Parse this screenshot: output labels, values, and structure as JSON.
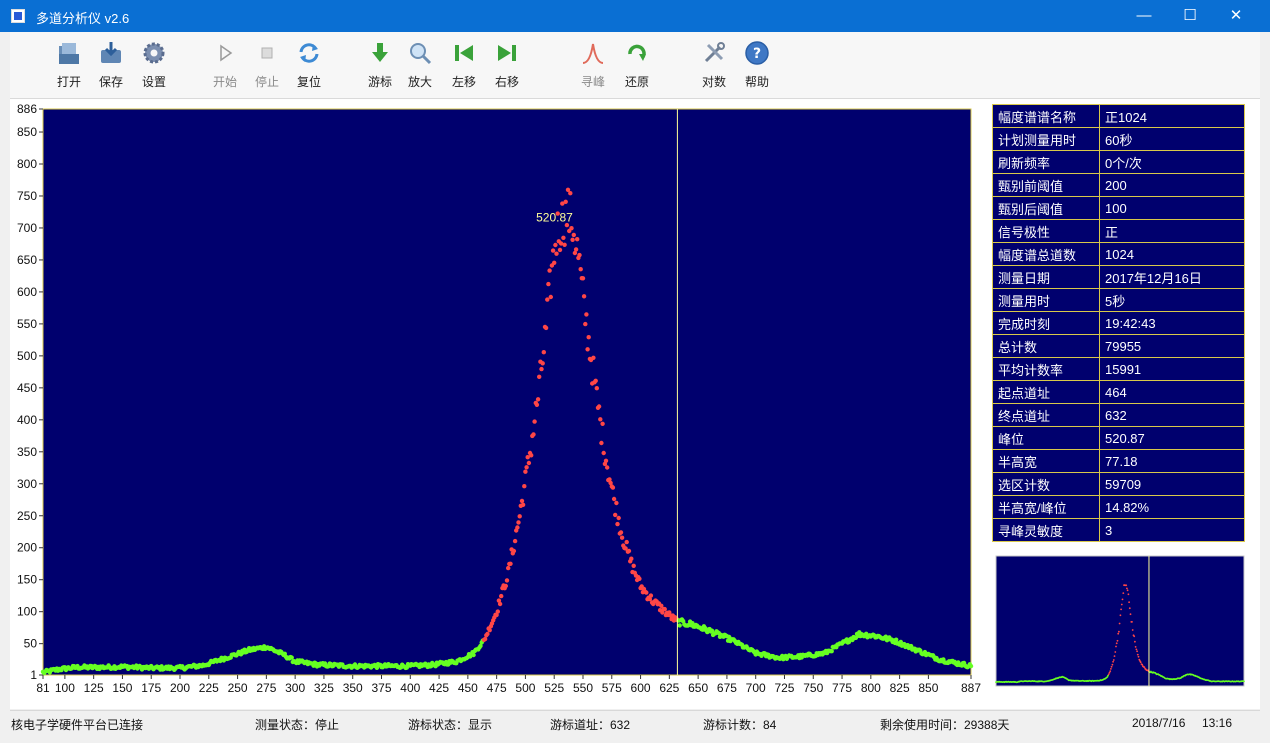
{
  "window": {
    "title": "多道分析仪 v2.6",
    "controls": {
      "minimize": "—",
      "maximize": "☐",
      "close": "✕"
    }
  },
  "toolbar": {
    "buttons": [
      {
        "id": "open",
        "label": "打开",
        "icon": "open-folder-icon",
        "enabled": true
      },
      {
        "id": "save",
        "label": "保存",
        "icon": "save-icon",
        "enabled": true
      },
      {
        "id": "settings",
        "label": "设置",
        "icon": "gear-icon",
        "enabled": true
      },
      {
        "id": "start",
        "label": "开始",
        "icon": "play-icon",
        "enabled": false
      },
      {
        "id": "stop",
        "label": "停止",
        "icon": "stop-icon",
        "enabled": false
      },
      {
        "id": "reset",
        "label": "复位",
        "icon": "reset-icon",
        "enabled": true
      },
      {
        "id": "cursor",
        "label": "游标",
        "icon": "down-arrow-icon",
        "enabled": true
      },
      {
        "id": "zoom",
        "label": "放大",
        "icon": "magnifier-icon",
        "enabled": true
      },
      {
        "id": "move-left",
        "label": "左移",
        "icon": "skip-left-icon",
        "enabled": true
      },
      {
        "id": "move-right",
        "label": "右移",
        "icon": "skip-right-icon",
        "enabled": true
      },
      {
        "id": "find-peak",
        "label": "寻峰",
        "icon": "peak-icon",
        "enabled": false
      },
      {
        "id": "restore",
        "label": "还原",
        "icon": "restore-icon",
        "enabled": true
      },
      {
        "id": "log",
        "label": "对数",
        "icon": "tools-icon",
        "enabled": true
      },
      {
        "id": "help",
        "label": "帮助",
        "icon": "help-icon",
        "enabled": true
      }
    ]
  },
  "info_table": [
    {
      "key": "幅度谱谱名称",
      "value": "正1024"
    },
    {
      "key": "计划测量用时",
      "value": "60秒"
    },
    {
      "key": "刷新频率",
      "value": "0个/次"
    },
    {
      "key": "甄别前阈值",
      "value": "200"
    },
    {
      "key": "甄别后阈值",
      "value": "100"
    },
    {
      "key": "信号极性",
      "value": "正"
    },
    {
      "key": "幅度谱总道数",
      "value": "1024"
    },
    {
      "key": "测量日期",
      "value": "2017年12月16日"
    },
    {
      "key": "测量用时",
      "value": "5秒"
    },
    {
      "key": "完成时刻",
      "value": "19:42:43"
    },
    {
      "key": "总计数",
      "value": "79955"
    },
    {
      "key": "平均计数率",
      "value": "15991"
    },
    {
      "key": "起点道址",
      "value": "464"
    },
    {
      "key": "终点道址",
      "value": "632"
    },
    {
      "key": "峰位",
      "value": "520.87"
    },
    {
      "key": "半高宽",
      "value": "77.18"
    },
    {
      "key": "选区计数",
      "value": "59709"
    },
    {
      "key": "半高宽/峰位",
      "value": "14.82%"
    },
    {
      "key": "寻峰灵敏度",
      "value": "3"
    }
  ],
  "status_bar": {
    "hardware": "核电子学硬件平台已连接",
    "measure_state": "测量状态：停止",
    "cursor_state": "游标状态：显示",
    "cursor_channel": "游标道址：632",
    "cursor_count": "游标计数：84",
    "remaining": "剩余使用时间：29388天",
    "date": "2018/7/16",
    "time": "13:16"
  },
  "colors": {
    "plot_bg": "#00006e",
    "region_points": "#ff4646",
    "background_points": "#66ff22",
    "cursor_line": "#ffff99",
    "peak_label": "#ffff99",
    "axis_frame": "#d9c84a"
  },
  "chart_data": {
    "type": "scatter",
    "title": "",
    "xlabel": "",
    "ylabel": "",
    "xlim": [
      81,
      887
    ],
    "ylim": [
      1,
      886
    ],
    "x_ticks": [
      81,
      100,
      125,
      150,
      175,
      200,
      225,
      250,
      275,
      300,
      325,
      350,
      375,
      400,
      425,
      450,
      475,
      500,
      525,
      550,
      575,
      600,
      625,
      650,
      675,
      700,
      725,
      750,
      775,
      800,
      825,
      850,
      887
    ],
    "y_ticks": [
      1,
      50,
      100,
      150,
      200,
      250,
      300,
      350,
      400,
      450,
      500,
      550,
      600,
      650,
      700,
      750,
      800,
      850,
      886
    ],
    "cursor_channel": 632,
    "peak_label": "520.87",
    "peak_label_position": [
      520.87,
      715
    ],
    "region": {
      "start": 464,
      "end": 632,
      "name": "选区"
    },
    "spectrum_profile": [
      [
        81,
        5
      ],
      [
        95,
        10
      ],
      [
        110,
        13
      ],
      [
        130,
        13
      ],
      [
        150,
        14
      ],
      [
        175,
        12
      ],
      [
        200,
        12
      ],
      [
        220,
        16
      ],
      [
        240,
        28
      ],
      [
        260,
        40
      ],
      [
        275,
        45
      ],
      [
        290,
        33
      ],
      [
        300,
        22
      ],
      [
        320,
        17
      ],
      [
        350,
        15
      ],
      [
        380,
        15
      ],
      [
        400,
        15
      ],
      [
        420,
        17
      ],
      [
        440,
        22
      ],
      [
        455,
        35
      ],
      [
        464,
        55
      ],
      [
        475,
        100
      ],
      [
        485,
        160
      ],
      [
        495,
        250
      ],
      [
        505,
        360
      ],
      [
        512,
        450
      ],
      [
        518,
        540
      ],
      [
        522,
        620
      ],
      [
        527,
        690
      ],
      [
        532,
        710
      ],
      [
        537,
        725
      ],
      [
        541,
        705
      ],
      [
        546,
        655
      ],
      [
        551,
        575
      ],
      [
        556,
        510
      ],
      [
        561,
        445
      ],
      [
        566,
        385
      ],
      [
        571,
        330
      ],
      [
        577,
        275
      ],
      [
        584,
        220
      ],
      [
        592,
        175
      ],
      [
        600,
        140
      ],
      [
        610,
        118
      ],
      [
        620,
        102
      ],
      [
        632,
        84
      ],
      [
        645,
        80
      ],
      [
        660,
        70
      ],
      [
        680,
        55
      ],
      [
        700,
        35
      ],
      [
        720,
        28
      ],
      [
        740,
        30
      ],
      [
        760,
        35
      ],
      [
        775,
        50
      ],
      [
        790,
        65
      ],
      [
        805,
        62
      ],
      [
        820,
        55
      ],
      [
        840,
        40
      ],
      [
        860,
        25
      ],
      [
        887,
        15
      ]
    ],
    "grid": false,
    "legend": "none"
  },
  "minimap": {
    "cursor_channel": 632,
    "xlim": [
      1,
      1024
    ]
  }
}
